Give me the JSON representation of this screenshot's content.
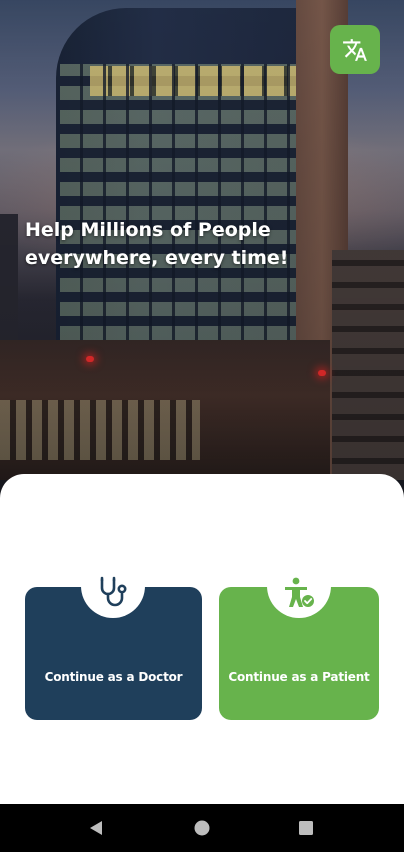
{
  "hero": {
    "title_line1": "Help Millions of People",
    "title_line2": "everywhere, every time!"
  },
  "language_button": {
    "icon": "translate-icon",
    "color": "#67b34c"
  },
  "roles": {
    "doctor": {
      "label": "Continue as a Doctor",
      "icon": "stethoscope-icon",
      "color": "#1f3f5b"
    },
    "patient": {
      "label": "Continue as a Patient",
      "icon": "patient-icon",
      "color": "#67b34c"
    }
  },
  "navigation_bar": {
    "back_icon": "back-triangle-icon",
    "home_icon": "home-circle-icon",
    "recents_icon": "recents-square-icon"
  }
}
